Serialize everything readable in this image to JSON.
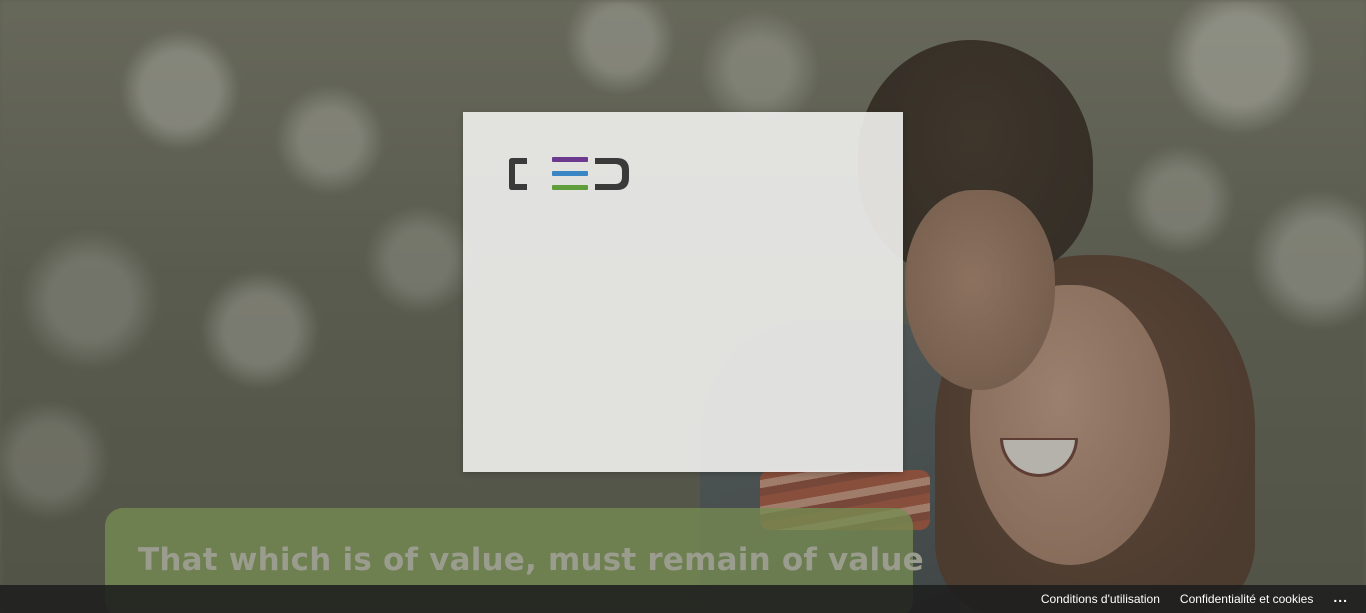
{
  "background": {
    "tagline": "That which is of value, must remain of value"
  },
  "logo": {
    "text": "CED",
    "bar_colors": [
      "#6b3a8e",
      "#3a86c4",
      "#5f9e3a"
    ],
    "letter_color": "#3a3a3a"
  },
  "footer": {
    "terms_label": "Conditions d'utilisation",
    "privacy_label": "Confidentialité et cookies",
    "more_label": "..."
  }
}
